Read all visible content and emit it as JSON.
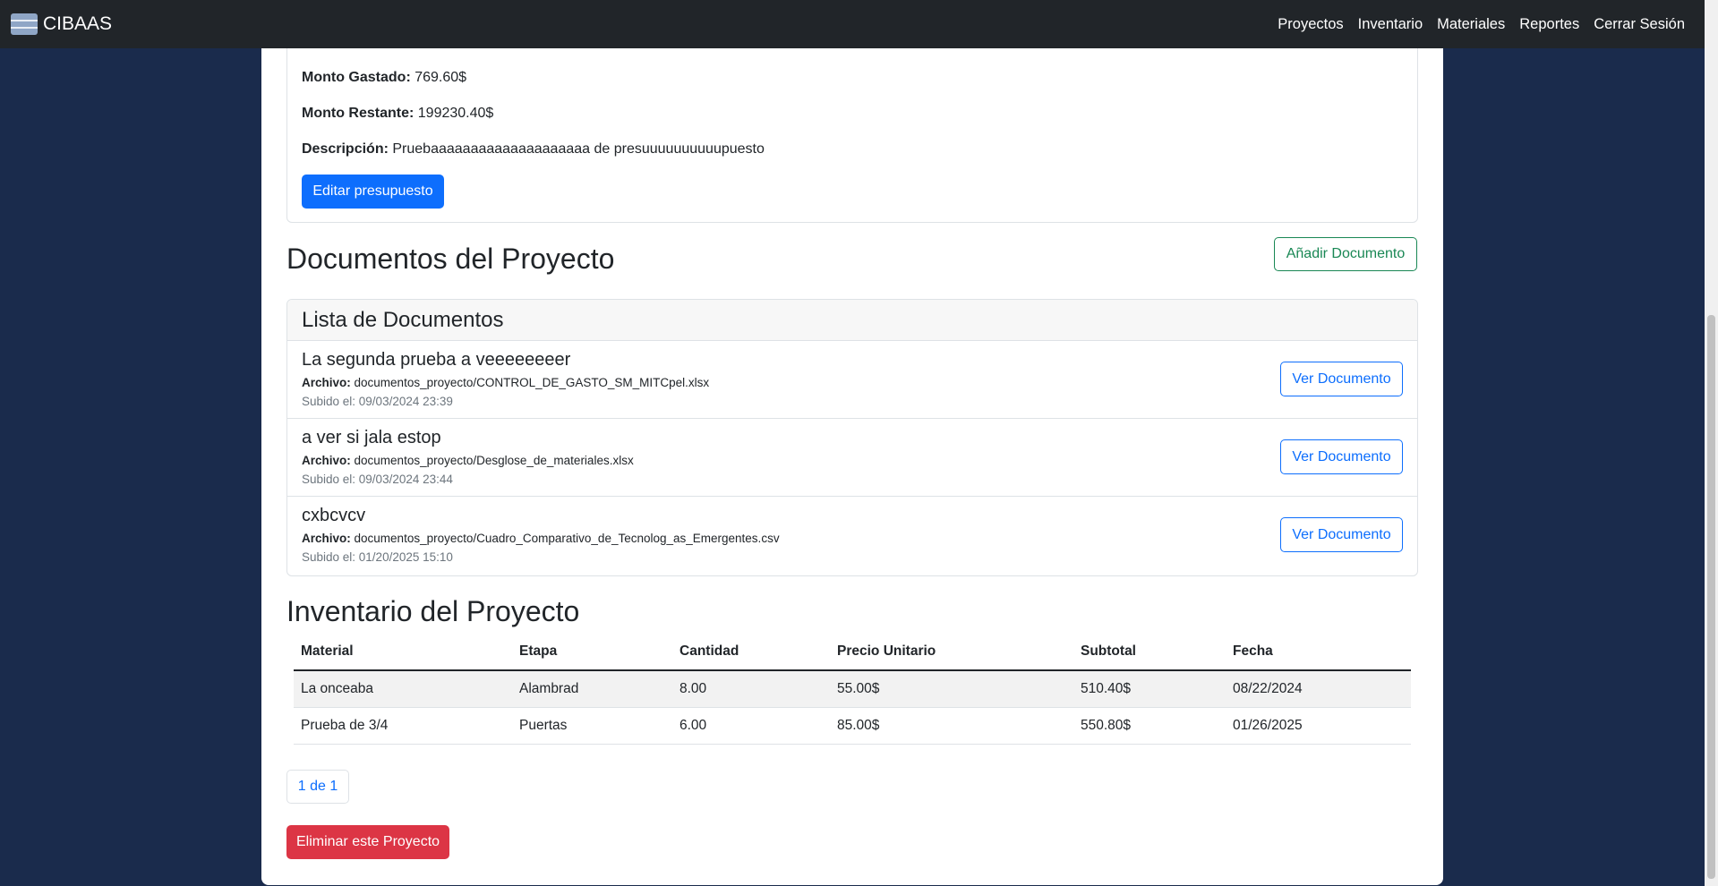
{
  "navbar": {
    "brand": "CIBAAS",
    "links": [
      "Proyectos",
      "Inventario",
      "Materiales",
      "Reportes",
      "Cerrar Sesión"
    ]
  },
  "budget": {
    "spent_label": "Monto Gastado:",
    "spent_value": "769.60$",
    "remaining_label": "Monto Restante:",
    "remaining_value": "199230.40$",
    "description_label": "Descripción:",
    "description_value": "Pruebaaaaaaaaaaaaaaaaaaaa de presuuuuuuuuuupuesto",
    "edit_button": "Editar presupuesto"
  },
  "documents": {
    "heading": "Documentos del Proyecto",
    "add_button": "Añadir Documento",
    "list_title": "Lista de Documentos",
    "file_label": "Archivo:",
    "view_button": "Ver Documento",
    "items": [
      {
        "title": "La segunda prueba a veeeeeeeer",
        "file": "documentos_proyecto/CONTROL_DE_GASTO_SM_MITCpel.xlsx",
        "uploaded": "Subido el: 09/03/2024 23:39"
      },
      {
        "title": "a ver si jala estop",
        "file": "documentos_proyecto/Desglose_de_materiales.xlsx",
        "uploaded": "Subido el: 09/03/2024 23:44"
      },
      {
        "title": "cxbcvcv",
        "file": "documentos_proyecto/Cuadro_Comparativo_de_Tecnolog_as_Emergentes.csv",
        "uploaded": "Subido el: 01/20/2025 15:10"
      }
    ]
  },
  "inventory": {
    "heading": "Inventario del Proyecto",
    "columns": [
      "Material",
      "Etapa",
      "Cantidad",
      "Precio Unitario",
      "Subtotal",
      "Fecha"
    ],
    "rows": [
      [
        "La onceaba",
        "Alambrad",
        "8.00",
        "55.00$",
        "510.40$",
        "08/22/2024"
      ],
      [
        "Prueba de 3/4",
        "Puertas",
        "6.00",
        "85.00$",
        "550.80$",
        "01/26/2025"
      ]
    ],
    "pagination": "1 de 1"
  },
  "delete_button": "Eliminar este Proyecto"
}
